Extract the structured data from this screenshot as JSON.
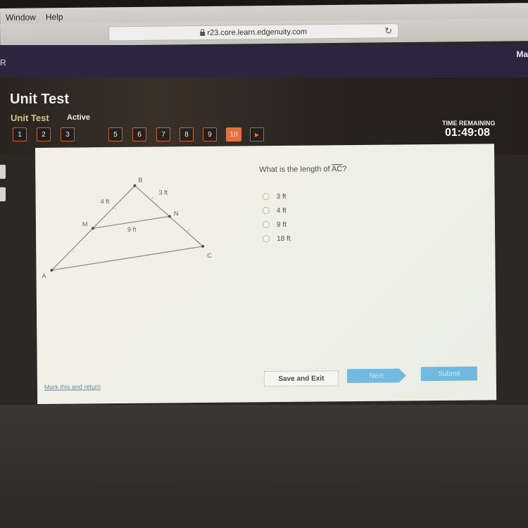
{
  "os_menu": {
    "items": [
      "Window",
      "Help"
    ]
  },
  "browser": {
    "url": "r23.core.learn.edgenuity.com",
    "lock_icon": "lock-icon",
    "reload_icon": "reload-icon"
  },
  "appbar": {
    "left_label": "R",
    "right_label": "Ma"
  },
  "header": {
    "title": "Unit Test",
    "subtitle": "Unit Test",
    "status": "Active",
    "time_label": "TIME REMAINING",
    "time_value": "01:49:08"
  },
  "question_nav": {
    "buttons": [
      "1",
      "2",
      "3",
      "5",
      "6",
      "7",
      "8",
      "9",
      "10"
    ],
    "active": "10",
    "next_icon": "play-arrow-icon"
  },
  "side_tools": [
    "calculator-icon",
    "formula-icon"
  ],
  "question": {
    "prefix": "What is the length of ",
    "segment": "AC",
    "suffix": "?",
    "options": [
      "3 ft",
      "4 ft",
      "9 ft",
      "18 ft"
    ]
  },
  "diagram": {
    "points": {
      "A": "A",
      "B": "B",
      "C": "C",
      "M": "M",
      "N": "N"
    },
    "labels": {
      "bm": "4 ft",
      "bn": "3 ft",
      "mn": "9 ft"
    }
  },
  "footer": {
    "mark_link": "Mark this and return",
    "save_exit": "Save and Exit",
    "next": "Next",
    "submit": "Submit"
  }
}
